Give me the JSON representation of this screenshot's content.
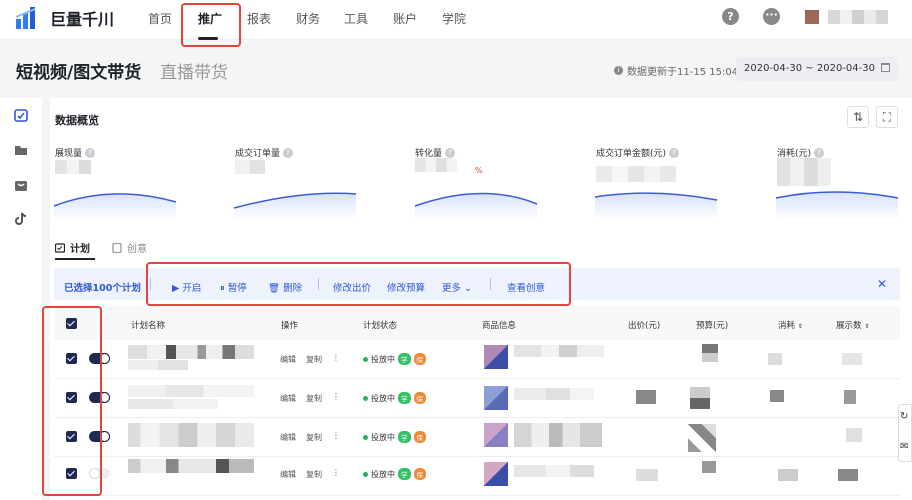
{
  "app": {
    "logo_text": "巨量千川"
  },
  "nav": {
    "items": [
      "首页",
      "推广",
      "报表",
      "财务",
      "工具",
      "账户",
      "学院"
    ],
    "active": "推广"
  },
  "header": {
    "help_icon": "?",
    "more_icon": "···"
  },
  "page": {
    "title": "短视频/图文带货",
    "alt_title": "直播带货",
    "updated_text": "数据更新于11-15 15:04",
    "date_range": "2020-04-30 ~ 2020-04-30"
  },
  "overview": {
    "title": "数据概览",
    "metrics": [
      {
        "label": "展现量"
      },
      {
        "label": "成交订单量"
      },
      {
        "label": "转化量",
        "value_suffix": "%"
      },
      {
        "label": "成交订单金额(元)"
      },
      {
        "label": "消耗(元)"
      }
    ]
  },
  "tabs": [
    {
      "label": "计划"
    },
    {
      "label": "创意"
    }
  ],
  "selection_bar": {
    "selected_text": "已选择100个计划",
    "actions": [
      "开启",
      "暂停",
      "删除",
      "修改出价",
      "修改预算",
      "更多",
      "查看创意"
    ]
  },
  "table": {
    "columns": [
      "计划名称",
      "操作",
      "计划状态",
      "商品信息",
      "出价(元)",
      "预算(元)",
      "消耗",
      "展示数"
    ],
    "row_ops": [
      "编辑",
      "复制"
    ],
    "rows": [
      {
        "status": "投放中",
        "badge1": "学",
        "badge2": "保",
        "enabled": true
      },
      {
        "status": "投放中",
        "badge1": "学",
        "badge2": "保",
        "enabled": true
      },
      {
        "status": "投放中",
        "badge1": "学",
        "badge2": "保",
        "enabled": true
      },
      {
        "status": "投放中",
        "badge1": "学",
        "badge2": "保",
        "enabled": false
      }
    ]
  },
  "colors": {
    "accent": "#2e59d9",
    "highlight_box": "#e0463c",
    "curve": "#3b5bdb"
  }
}
